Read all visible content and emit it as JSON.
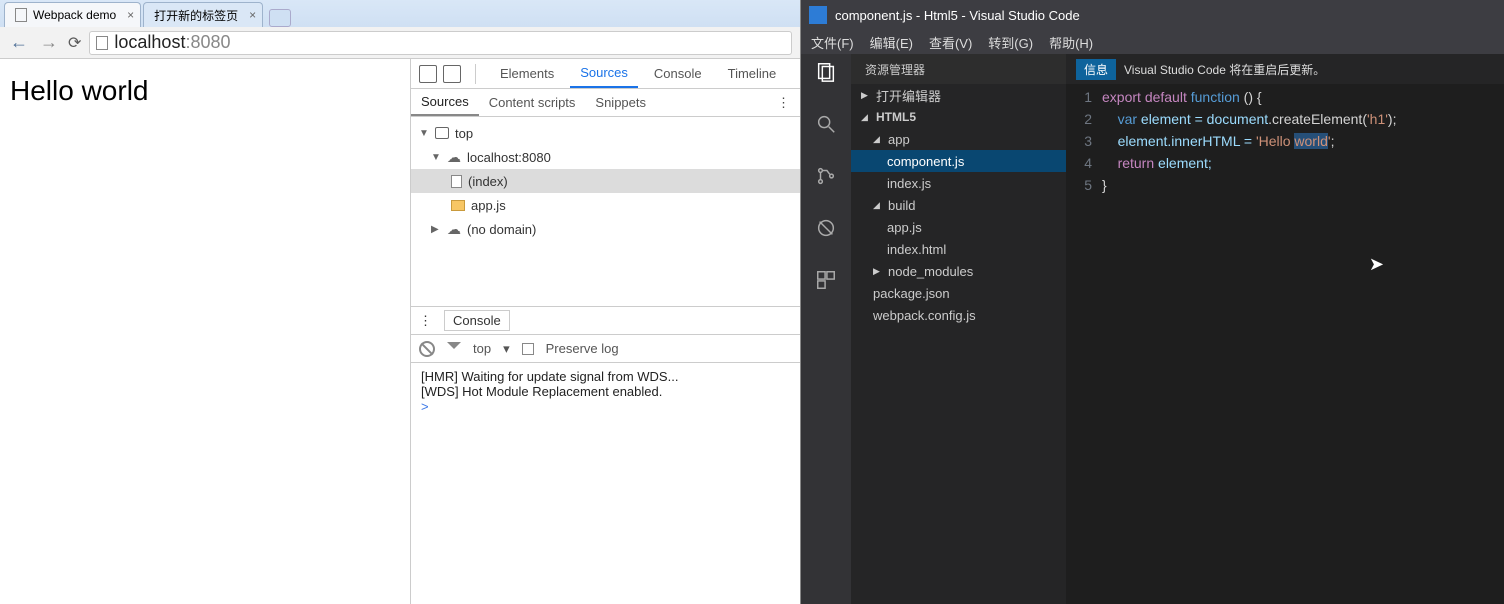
{
  "chrome": {
    "tabs": [
      {
        "title": "Webpack demo"
      },
      {
        "title": "打开新的标签页"
      }
    ],
    "url_host": "localhost",
    "url_port": ":8080",
    "page_text": "Hello world",
    "devtools": {
      "tabs": [
        "Elements",
        "Sources",
        "Console",
        "Timeline"
      ],
      "active_tab": "Sources",
      "subtabs": [
        "Sources",
        "Content scripts",
        "Snippets"
      ],
      "active_subtab": "Sources",
      "tree": {
        "top": "top",
        "domain": "localhost:8080",
        "files": [
          "(index)",
          "app.js"
        ],
        "nodomain": "(no domain)"
      },
      "console_label": "Console",
      "filter_scope": "top",
      "preserve_label": "Preserve log",
      "log1": "[HMR] Waiting for update signal from WDS...",
      "log2": "[WDS] Hot Module Replacement enabled.",
      "prompt": ">"
    }
  },
  "vscode": {
    "title": "component.js - Html5 - Visual Studio Code",
    "menu": [
      "文件(F)",
      "编辑(E)",
      "查看(V)",
      "转到(G)",
      "帮助(H)"
    ],
    "explorer_header": "资源管理器",
    "open_editors": "打开编辑器",
    "project": "HTML5",
    "folders": {
      "app": "app",
      "app_files": [
        "component.js",
        "index.js"
      ],
      "build": "build",
      "build_files": [
        "app.js",
        "index.html"
      ],
      "node_modules": "node_modules",
      "root_files": [
        "package.json",
        "webpack.config.js"
      ]
    },
    "info_badge": "信息",
    "info_text": "Visual Studio Code 将在重启后更新。",
    "code": {
      "l1_export": "export",
      "l1_default": "default",
      "l1_function": "function",
      "l1_rest": " () {",
      "l2_var": "var",
      "l2_ident": " element = ",
      "l2_doc": "document",
      "l2_call": ".createElement(",
      "l2_str": "'h1'",
      "l2_end": ");",
      "l3_a": "element.innerHTML = ",
      "l3_str1": "'Hello ",
      "l3_str2": "world",
      "l3_str3": "'",
      "l3_end": ";",
      "l4_ret": "return",
      "l4_ident": " element;",
      "l5": "}"
    }
  }
}
